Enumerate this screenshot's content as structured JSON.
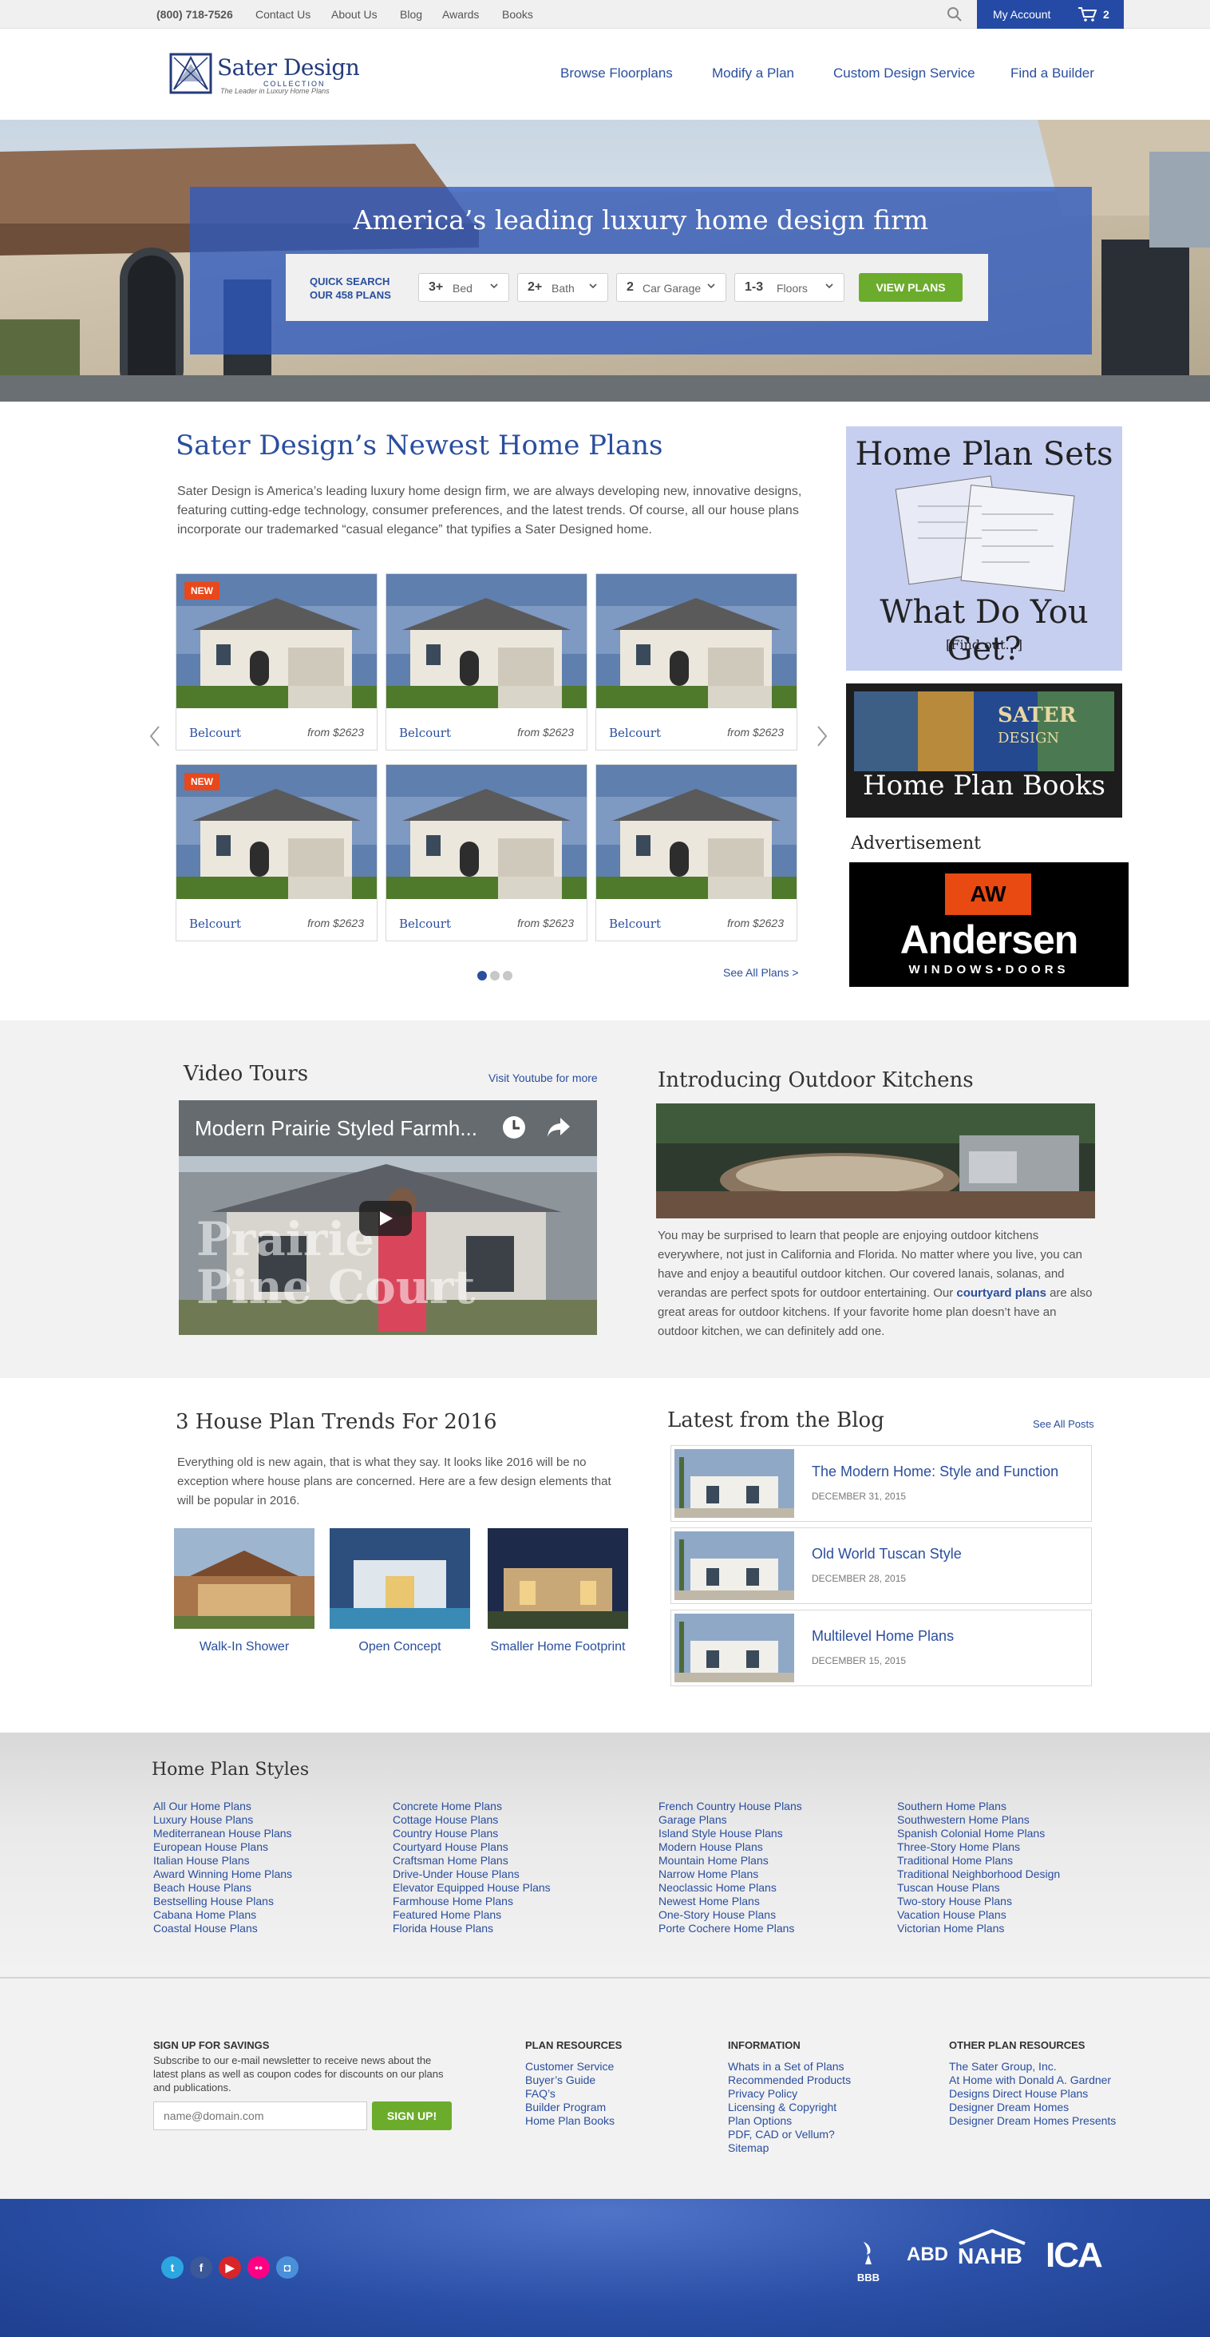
{
  "topbar": {
    "phone": "(800) 718-7526",
    "links": [
      "Contact Us",
      "About Us",
      "Blog",
      "Awards",
      "Books"
    ],
    "account_label": "My Account",
    "cart_count": "2"
  },
  "header": {
    "logo_name": "Sater Design",
    "logo_collection": "COLLECTION",
    "logo_tagline": "The Leader in Luxury Home Plans",
    "nav": [
      "Browse Floorplans",
      "Modify a Plan",
      "Custom Design Service",
      "Find a Builder"
    ]
  },
  "hero": {
    "title": "America’s leading luxury home design firm",
    "quick_search_l1": "QUICK SEARCH",
    "quick_search_l2": "OUR 458 PLANS",
    "selects": [
      {
        "value": "3+",
        "unit": "Bed"
      },
      {
        "value": "2+",
        "unit": "Bath"
      },
      {
        "value": "2",
        "unit": "Car Garage"
      },
      {
        "value": "1-3",
        "unit": "Floors"
      }
    ],
    "button": "VIEW PLANS"
  },
  "newest": {
    "title": "Sater Design’s Newest Home Plans",
    "description": "Sater Design is America’s leading luxury home design firm, we are always developing new, innovative designs, featuring cutting-edge technology, consumer preferences, and the latest trends. Of course, all our house plans incorporate our trademarked “casual elegance” that typifies a Sater Designed home.",
    "new_badge": "NEW",
    "cards": [
      {
        "name": "Belcourt",
        "price": "from $2623"
      },
      {
        "name": "Belcourt",
        "price": "from $2623"
      },
      {
        "name": "Belcourt",
        "price": "from $2623"
      },
      {
        "name": "Belcourt",
        "price": "from $2623"
      },
      {
        "name": "Belcourt",
        "price": "from $2623"
      },
      {
        "name": "Belcourt",
        "price": "from $2623"
      }
    ],
    "see_all": "See All Plans  >"
  },
  "sidebar": {
    "sets_title": "Home Plan Sets",
    "sets_question": "What Do You Get?",
    "sets_link": "[Find out...]",
    "books_title": "Home Plan Books",
    "advertisement": "Advertisement",
    "andersen_name": "Andersen",
    "andersen_sub": "WINDOWS•DOORS",
    "andersen_logo": "AW"
  },
  "video": {
    "title": "Video Tours",
    "youtube_link": "Visit Youtube for more",
    "video_title": "Modern Prairie Styled Farmh...",
    "overlay_l1": "Prairie",
    "overlay_l2": "Pine Court"
  },
  "kitchens": {
    "title": "Introducing Outdoor Kitchens",
    "text_before": "You may be surprised to learn that people are enjoying outdoor kitchens everywhere, not just in California and Florida. No matter where you live, you can have and enjoy a beautiful outdoor kitchen. Our covered lanais, solanas, and verandas are perfect spots for outdoor entertaining. Our ",
    "link": "courtyard plans",
    "text_after": " are also great areas for outdoor kitchens. If your favorite home plan doesn’t have an outdoor kitchen, we can definitely add one."
  },
  "trends": {
    "title": "3 House Plan Trends For 2016",
    "text": "Everything old is new again, that is what they say. It looks like 2016 will be no exception where house plans are concerned. Here are a few design elements that will be popular in 2016.",
    "items": [
      "Walk-In Shower",
      "Open Concept",
      "Smaller Home Footprint"
    ]
  },
  "blog": {
    "title": "Latest from the Blog",
    "see_all": "See All Posts",
    "posts": [
      {
        "title": "The Modern Home: Style and Function",
        "date": "DECEMBER 31, 2015"
      },
      {
        "title": "Old World Tuscan Style",
        "date": "DECEMBER 28, 2015"
      },
      {
        "title": "Multilevel Home Plans",
        "date": "DECEMBER 15, 2015"
      }
    ]
  },
  "styles": {
    "title": "Home Plan Styles",
    "col1": [
      "All Our Home Plans",
      "Luxury House Plans",
      "Mediterranean House Plans",
      "European House Plans",
      "Italian House Plans",
      "Award Winning Home Plans",
      "Beach House Plans",
      "Bestselling House Plans",
      "Cabana Home Plans",
      "Coastal House Plans"
    ],
    "col2": [
      "Concrete Home Plans",
      "Cottage House Plans",
      "Country House Plans",
      "Courtyard House Plans",
      "Craftsman Home Plans",
      "Drive-Under House Plans",
      "Elevator Equipped House Plans",
      "Farmhouse Home Plans",
      "Featured Home Plans",
      "Florida House Plans"
    ],
    "col3": [
      "French Country House Plans",
      "Garage Plans",
      "Island Style House Plans",
      "Modern House Plans",
      "Mountain Home Plans",
      "Narrow Home Plans",
      "Neoclassic Home Plans",
      "Newest Home Plans",
      "One-Story House Plans",
      "Porte Cochere Home Plans"
    ],
    "col4": [
      "Southern Home Plans",
      "Southwestern Home Plans",
      "Spanish Colonial Home Plans",
      "Three-Story Home Plans",
      "Traditional Home Plans",
      "Traditional Neighborhood Design",
      "Tuscan House Plans",
      "Two-story House Plans",
      "Vacation House Plans",
      "Victorian Home Plans"
    ]
  },
  "footer": {
    "signup_title": "SIGN UP FOR SAVINGS",
    "signup_text": "Subscribe to our e-mail newsletter to receive news about the latest plans as well as coupon codes for discounts on our plans and publications.",
    "email_placeholder": "name@domain.com",
    "signup_button": "SIGN UP!",
    "plan_resources_title": "PLAN RESOURCES",
    "plan_resources": [
      "Customer Service",
      "Buyer’s Guide",
      "FAQ’s",
      "Builder Program",
      "Home Plan Books"
    ],
    "information_title": "INFORMATION",
    "information": [
      "Whats in a Set of Plans",
      "Recommended Products",
      "Privacy Policy",
      "Licensing & Copyright",
      "Plan Options",
      "PDF, CAD or Vellum?",
      "Sitemap"
    ],
    "other_title": "OTHER PLAN RESOURCES",
    "other": [
      "The Sater Group, Inc.",
      "At Home with Donald A. Gardner",
      "Designs Direct House Plans",
      "Designer Dream Homes",
      "Designer Dream Homes Presents"
    ]
  },
  "bottom": {
    "social": [
      {
        "icon": "twitter-icon",
        "glyph": "t",
        "color": "#2ca6e0"
      },
      {
        "icon": "facebook-icon",
        "glyph": "f",
        "color": "#3b5998"
      },
      {
        "icon": "youtube-icon",
        "glyph": "▶",
        "color": "#d9252a"
      },
      {
        "icon": "flickr-icon",
        "glyph": "••",
        "color": "#ff0084"
      },
      {
        "icon": "instagram-icon",
        "glyph": "◘",
        "color": "#4a90d9"
      }
    ],
    "badges": [
      "BBB",
      "ABD",
      "NAHB",
      "ICA"
    ]
  },
  "colors": {
    "brand_blue": "#254aa5",
    "link_blue": "#2a4e9e",
    "green": "#6cac2c",
    "badge_red": "#e8481b"
  }
}
